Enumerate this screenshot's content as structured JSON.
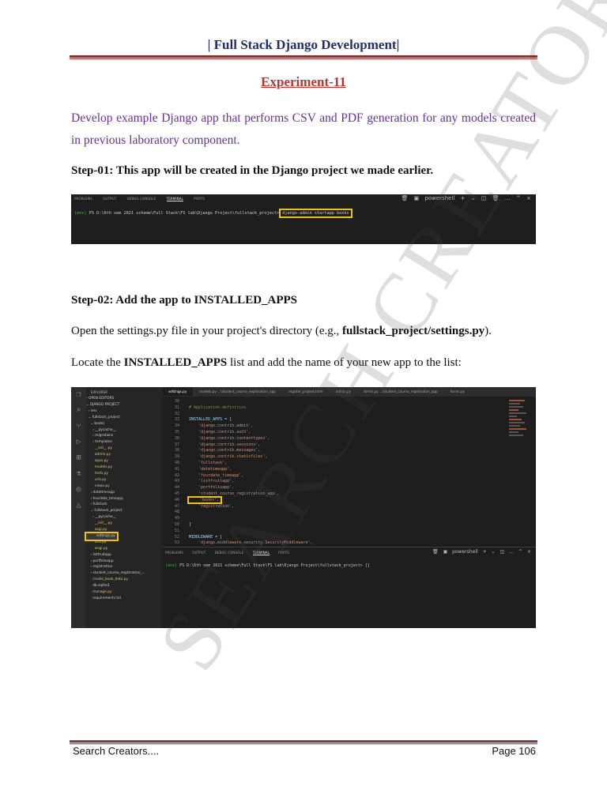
{
  "header": {
    "title": "| Full Stack Django Development|"
  },
  "experiment_title": "Experiment-11",
  "intro": "Develop example Django app that performs CSV and PDF generation for any models created in previous laboratory component.",
  "step1": {
    "label": "Step-01",
    "text": ": This app will be created in the Django project we made earlier."
  },
  "terminal": {
    "tabs": [
      "PROBLEMS",
      "OUTPUT",
      "DEBUG CONSOLE",
      "TERMINAL",
      "PORTS"
    ],
    "active_tab": "TERMINAL",
    "shell": "powershell",
    "env": "(env)",
    "prompt": " PS D:\\6th sem 2021 scheme\\Full Stack\\FS lab\\Django Project\\fullstack_project>",
    "command": "django-admin startapp books"
  },
  "step2": {
    "heading": "Step-02: Add the app to INSTALLED_APPS"
  },
  "open_settings": {
    "text": "Open the settings.py file in your project's directory (e.g., ",
    "bold": "fullstack_project/settings.py",
    "end": ")."
  },
  "locate": {
    "pre": "Locate the ",
    "bold": "INSTALLED_APPS",
    "post": " list and add the name of your new app to the list:"
  },
  "vscode": {
    "explorer_title": "EXPLORER",
    "tree": [
      "› OPEN EDITORS",
      "⌄ DJANGO PROJECT",
      "  › env",
      "  ⌄ fullstack_project",
      "    ⌄ books",
      "      › __pycache__",
      "      › migrations",
      "      › templates",
      "        __init__.py",
      "        admin.py",
      "        apps.py",
      "        models.py",
      "        tests.py",
      "        urls.py",
      "        views.py",
      "    › datetimeapp",
      "    › fourdate_timeapp",
      "    › fullstack",
      "    ⌄ fullstack_project",
      "      › __pycache__",
      "        __init__.py",
      "        asgi.py",
      "        settings.py",
      "        urls.py",
      "        wsgi.py",
      "    › listfruitapp",
      "    › portfolioapp",
      "    › registration",
      "    › student_course_registration_...",
      "      create_book_data.py",
      "      db.sqlite3",
      "      manage.py",
      "      requirements.txt"
    ],
    "editor_tabs": [
      "settings.py",
      "models.py ...\\student_course_registration_app",
      "register_project.html",
      "admin.py",
      "forms.py ...\\student_course_registration_app",
      "forms.py"
    ],
    "code": [
      {
        "n": "30",
        "t": ""
      },
      {
        "n": "31",
        "t": "# Application definition",
        "c": "cm"
      },
      {
        "n": "32",
        "t": ""
      },
      {
        "n": "33",
        "t": "INSTALLED_APPS = [",
        "c": "kw"
      },
      {
        "n": "34",
        "t": "    'django.contrib.admin',"
      },
      {
        "n": "35",
        "t": "    'django.contrib.auth',"
      },
      {
        "n": "36",
        "t": "    'django.contrib.contenttypes',"
      },
      {
        "n": "37",
        "t": "    'django.contrib.sessions',"
      },
      {
        "n": "38",
        "t": "    'django.contrib.messages',"
      },
      {
        "n": "39",
        "t": "    'django.contrib.staticfiles',"
      },
      {
        "n": "40",
        "t": "    'fullstack',"
      },
      {
        "n": "41",
        "t": "    'datetimeapp',"
      },
      {
        "n": "42",
        "t": "    'fourdate_timeapp',"
      },
      {
        "n": "43",
        "t": "    'listfruitapp',"
      },
      {
        "n": "44",
        "t": "    'portfolioapp',"
      },
      {
        "n": "45",
        "t": "    'student_course_registration_app',"
      },
      {
        "n": "46",
        "t": "    'books',",
        "h": true
      },
      {
        "n": "47",
        "t": "    'registration',"
      },
      {
        "n": "48",
        "t": ""
      },
      {
        "n": "49",
        "t": ""
      },
      {
        "n": "50",
        "t": "]",
        "c": "kw"
      },
      {
        "n": "51",
        "t": ""
      },
      {
        "n": "52",
        "t": "MIDDLEWARE = [",
        "c": "kw"
      },
      {
        "n": "53",
        "t": "    'django.middleware.security.SecurityMiddleware',"
      },
      {
        "n": "54",
        "t": "    'django.contrib.sessions.middleware.SessionMiddleware',"
      }
    ],
    "panel_prompt": " PS D:\\6th sem 2021 scheme\\Full Stack\\FS lab\\Django Project\\fullstack_project> []"
  },
  "watermark": "SEARCH CREATORS",
  "footer": {
    "left": "Search Creators....",
    "right": "Page 106"
  }
}
